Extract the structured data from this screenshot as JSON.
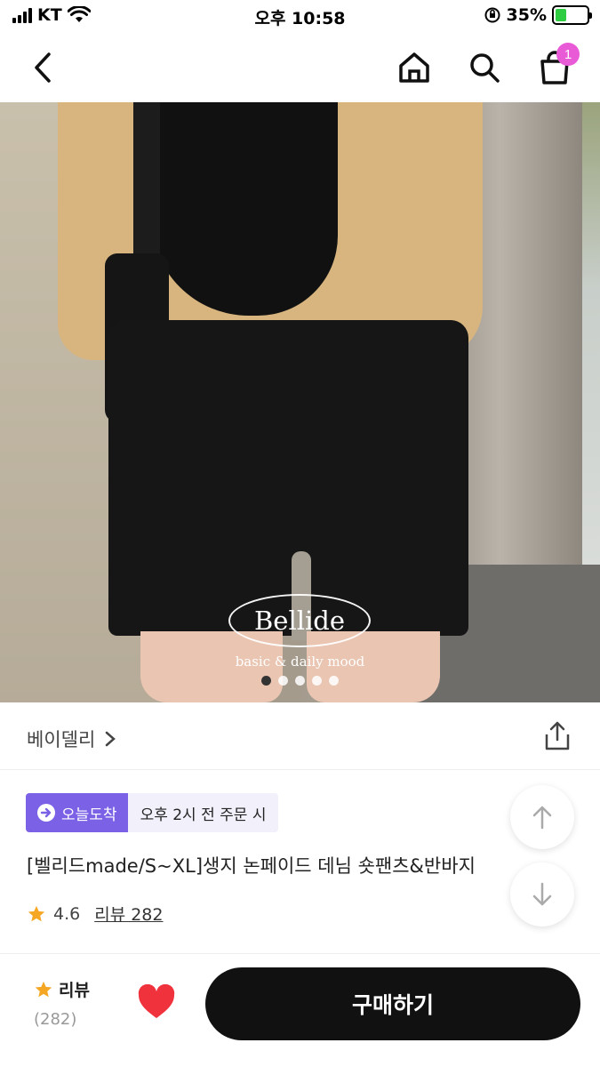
{
  "status_bar": {
    "carrier": "KT",
    "time": "오후 10:58",
    "battery_percent": "35%",
    "battery_level": 0.35
  },
  "nav": {
    "cart_count": "1",
    "icons": [
      "back-chevron-icon",
      "home-icon",
      "search-icon",
      "shopping-bag-icon"
    ]
  },
  "hero": {
    "brand_logo": "Bellide",
    "brand_tagline": "basic & daily mood",
    "image_count": 5,
    "active_index": 0
  },
  "seller": {
    "name": "베이델리"
  },
  "delivery": {
    "badge": "오늘도착",
    "note": "오후 2시 전 주문 시"
  },
  "product": {
    "title": "[벨리드made/S~XL]생지 논페이드 데님 숏팬츠&반바지",
    "rating": "4.6",
    "review_link": "리뷰 282"
  },
  "bottom": {
    "review_label": "리뷰",
    "review_count": "(282)",
    "buy_label": "구매하기"
  },
  "colors": {
    "accent_purple": "#7b61e6",
    "badge_pink": "#e95bd6",
    "heart_red": "#f0323c",
    "star_orange": "#f5a623"
  }
}
